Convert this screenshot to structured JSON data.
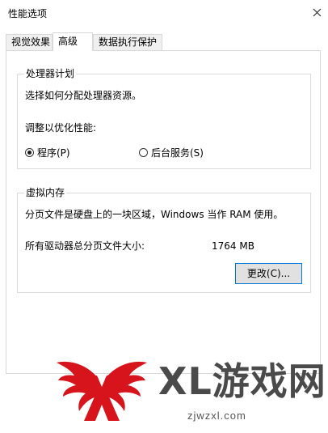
{
  "window": {
    "title": "性能选项"
  },
  "tabs": [
    {
      "label": "视觉效果",
      "active": false
    },
    {
      "label": "高级",
      "active": true
    },
    {
      "label": "数据执行保护",
      "active": false
    }
  ],
  "processor": {
    "group_title": "处理器计划",
    "description": "选择如何分配处理器资源。",
    "adjust_label": "调整以优化性能:",
    "options": [
      {
        "label": "程序(P)",
        "checked": true
      },
      {
        "label": "后台服务(S)",
        "checked": false
      }
    ]
  },
  "virtual_memory": {
    "group_title": "虚拟内存",
    "description": "分页文件是硬盘上的一块区域，Windows 当作 RAM 使用。",
    "total_label": "所有驱动器总分页文件大小:",
    "total_value": "1764 MB",
    "change_button": "更改(C)..."
  },
  "watermark": {
    "brand": "XL游戏网",
    "site": "zjwzxl.com",
    "colors": {
      "brand_text": "#4a4a4a",
      "logo_red": "#d7141c"
    }
  }
}
